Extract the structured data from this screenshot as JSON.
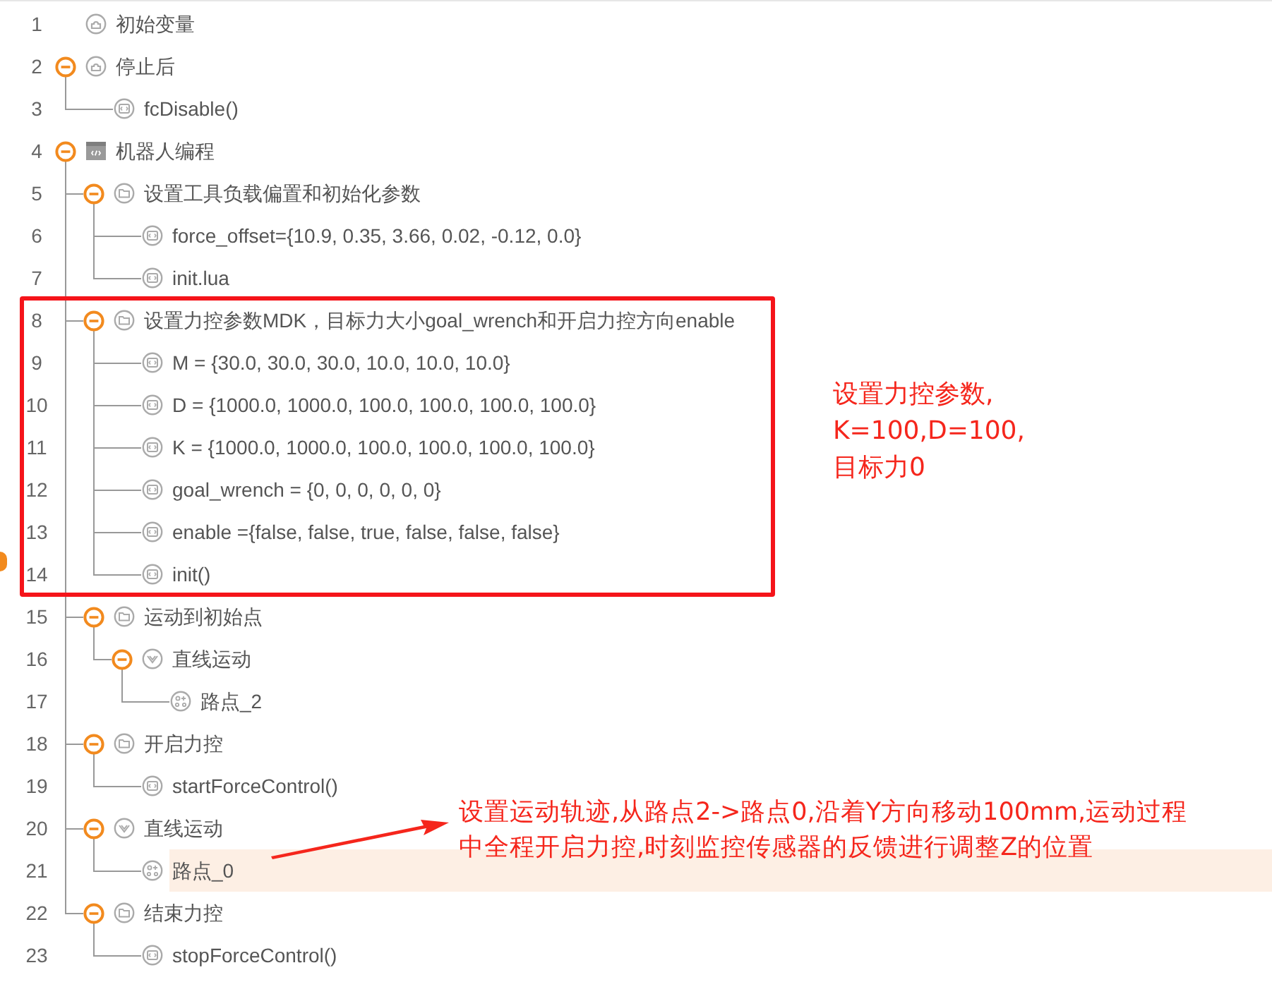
{
  "program_tree": [
    {
      "number": "1",
      "label": "初始变量",
      "kind": "start",
      "selected": false
    },
    {
      "number": "2",
      "label": "停止后",
      "kind": "start",
      "selected": false,
      "expanded": true,
      "children": [
        {
          "number": "3",
          "label": "fcDisable()",
          "kind": "code",
          "selected": false
        }
      ]
    },
    {
      "number": "4",
      "label": "机器人编程",
      "kind": "program",
      "selected": false,
      "expanded": true,
      "children": [
        {
          "number": "5",
          "label": "设置工具负载偏置和初始化参数",
          "kind": "folder",
          "selected": false,
          "expanded": true,
          "children": [
            {
              "number": "6",
              "label": "force_offset={10.9, 0.35, 3.66, 0.02, -0.12, 0.0}",
              "kind": "code",
              "selected": false
            },
            {
              "number": "7",
              "label": "init.lua",
              "kind": "code",
              "selected": false
            }
          ]
        },
        {
          "number": "8",
          "label": "设置力控参数MDK，目标力大小goal_wrench和开启力控方向enable",
          "kind": "folder",
          "selected": false,
          "expanded": true,
          "children": [
            {
              "number": "9",
              "label": "M = {30.0, 30.0, 30.0, 10.0, 10.0, 10.0}",
              "kind": "code",
              "selected": false
            },
            {
              "number": "10",
              "label": "D = {1000.0, 1000.0, 100.0, 100.0, 100.0, 100.0}",
              "kind": "code",
              "selected": false
            },
            {
              "number": "11",
              "label": "K = {1000.0, 1000.0, 100.0, 100.0, 100.0, 100.0}",
              "kind": "code",
              "selected": false
            },
            {
              "number": "12",
              "label": "goal_wrench = {0, 0, 0, 0, 0, 0}",
              "kind": "code",
              "selected": false
            },
            {
              "number": "13",
              "label": "enable ={false, false, true, false, false, false}",
              "kind": "code",
              "selected": false
            },
            {
              "number": "14",
              "label": "init()",
              "kind": "code",
              "selected": false
            }
          ]
        },
        {
          "number": "15",
          "label": "运动到初始点",
          "kind": "folder",
          "selected": false,
          "expanded": true,
          "children": [
            {
              "number": "16",
              "label": "直线运动",
              "kind": "move",
              "selected": false,
              "expanded": true,
              "children": [
                {
                  "number": "17",
                  "label": "路点_2",
                  "kind": "waypoint",
                  "selected": false
                }
              ]
            }
          ]
        },
        {
          "number": "18",
          "label": "开启力控",
          "kind": "folder",
          "selected": false,
          "expanded": true,
          "children": [
            {
              "number": "19",
              "label": "startForceControl()",
              "kind": "code",
              "selected": false
            }
          ]
        },
        {
          "number": "20",
          "label": "直线运动",
          "kind": "move",
          "selected": false,
          "expanded": true,
          "children": [
            {
              "number": "21",
              "label": "路点_0",
              "kind": "waypoint",
              "selected": true
            }
          ]
        },
        {
          "number": "22",
          "label": "结束力控",
          "kind": "folder",
          "selected": false,
          "expanded": true,
          "children": [
            {
              "number": "23",
              "label": "stopForceControl()",
              "kind": "code",
              "selected": false
            }
          ]
        }
      ]
    }
  ],
  "annotations": [
    {
      "kind": "box"
    },
    {
      "kind": "note",
      "lines": [
        "设置力控参数,",
        "K=100,D=100,",
        "目标力0"
      ]
    },
    {
      "kind": "arrow_note",
      "lines": [
        "设置运动轨迹,从路点2->路点0,沿着Y方向移动100mm,运动过程",
        "中全程开启力控,时刻监控传感器的反馈进行调整Z的位置"
      ]
    }
  ]
}
